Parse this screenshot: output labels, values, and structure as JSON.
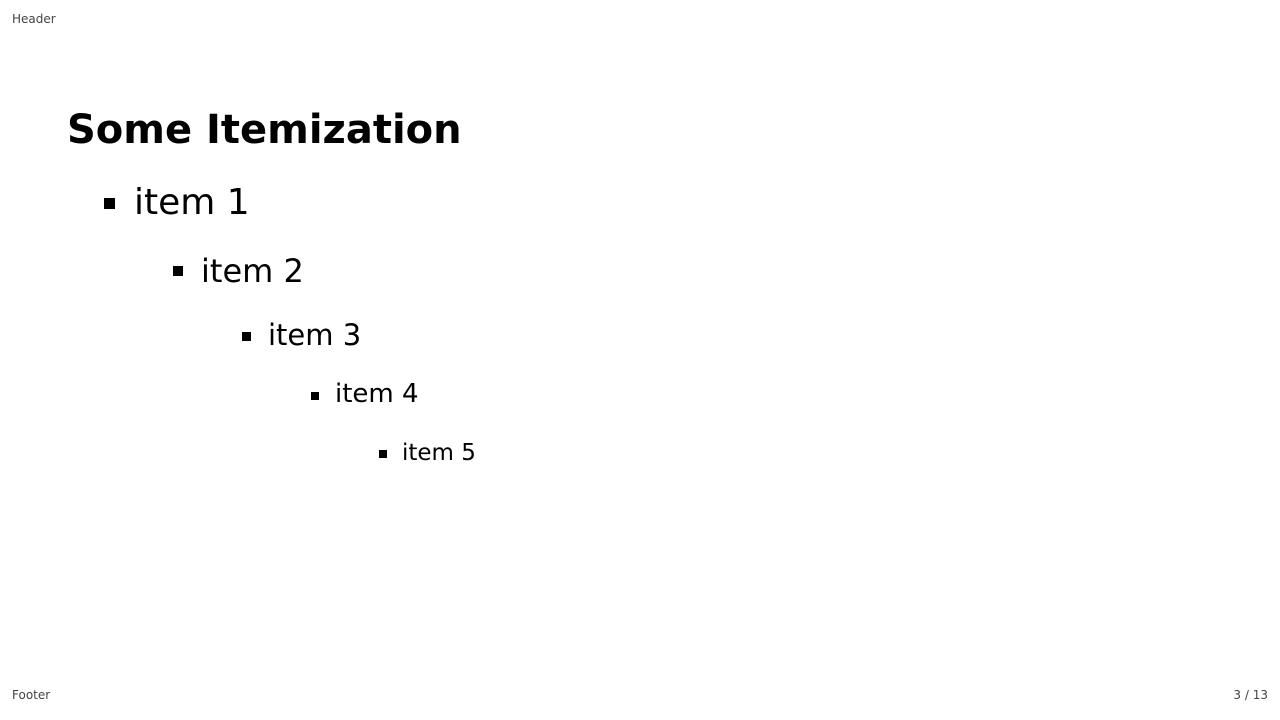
{
  "header": {
    "text": "Header"
  },
  "footer": {
    "text": "Footer"
  },
  "page_number": "3 / 13",
  "slide": {
    "title": "Some Itemization",
    "items": [
      {
        "label": "item 1"
      },
      {
        "label": "item 2"
      },
      {
        "label": "item 3"
      },
      {
        "label": "item 4"
      },
      {
        "label": "item 5"
      }
    ]
  }
}
